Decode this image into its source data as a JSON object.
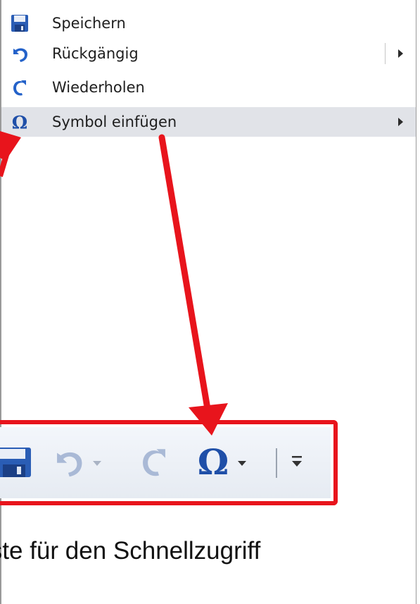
{
  "context_menu": {
    "items": [
      {
        "label": "Speichern",
        "icon": "save-icon",
        "has_submenu": false,
        "highlighted": false
      },
      {
        "label": "Rückgängig",
        "icon": "undo-icon",
        "has_submenu": true,
        "highlighted": false
      },
      {
        "label": "Wiederholen",
        "icon": "redo-icon",
        "has_submenu": false,
        "highlighted": false
      },
      {
        "label": "Symbol einfügen",
        "icon": "omega-symbol-icon",
        "has_submenu": true,
        "highlighted": true
      }
    ]
  },
  "quick_access_toolbar": {
    "buttons": [
      "save-icon",
      "undo-icon",
      "undo-dropdown-icon",
      "redo-icon",
      "omega-symbol-icon",
      "omega-dropdown-icon",
      "customize-toolbar-icon"
    ]
  },
  "caption": {
    "text": "iste für den Schnellzugriff"
  },
  "colors": {
    "highlight_box": "#e8141c",
    "arrow": "#e8141c",
    "icon_blue": "#1f5fbf",
    "menu_highlight": "#e1e3e8"
  }
}
